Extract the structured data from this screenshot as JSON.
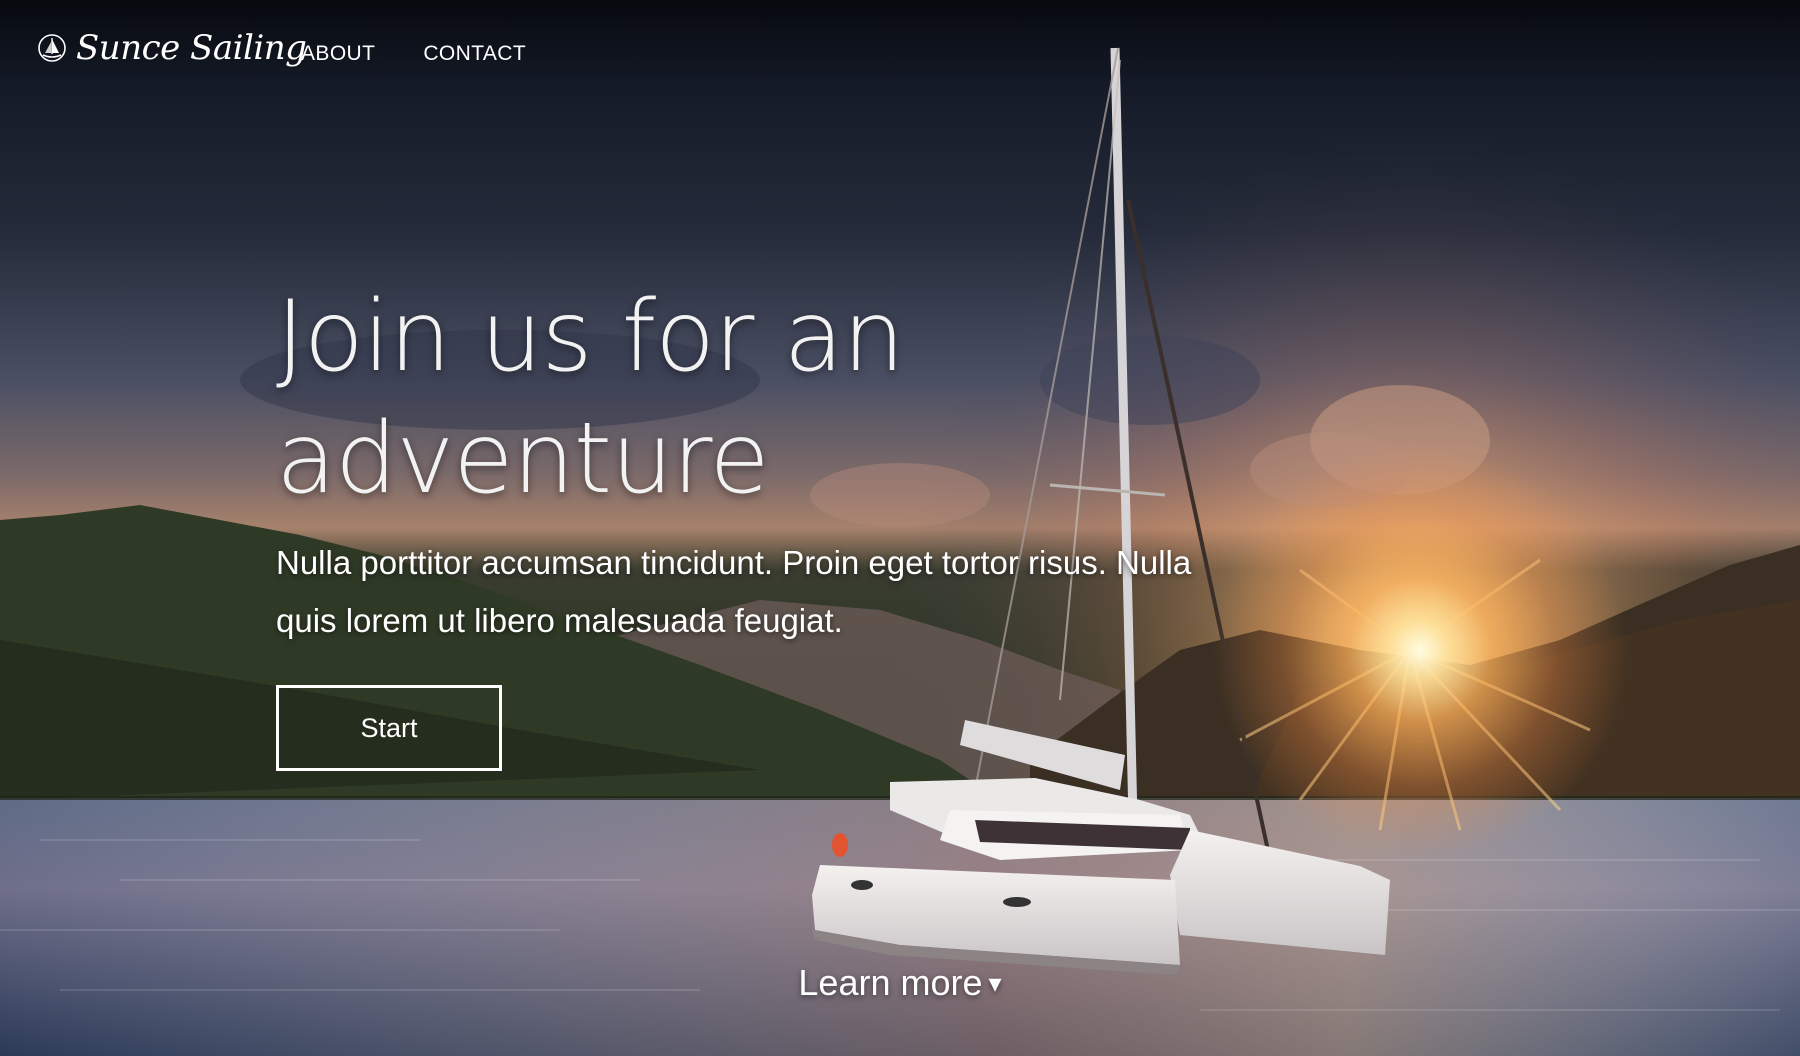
{
  "brand": {
    "name": "Sunce Sailing",
    "icon": "sailboat-logo-icon"
  },
  "nav": {
    "items": [
      {
        "label": "ABOUT"
      },
      {
        "label": "CONTACT"
      }
    ]
  },
  "hero": {
    "headline_line1": "Join us for an",
    "headline_line2": "adventure",
    "subtext_line1": "Nulla porttitor accumsan tincidunt. Proin eget tortor risus. Nulla",
    "subtext_line2": "quis lorem ut libero malesuada feugiat.",
    "cta_label": "Start",
    "learn_more_label": "Learn more",
    "learn_more_icon": "▾"
  },
  "colors": {
    "text": "#ffffff",
    "sky_dark": "#141a26",
    "sunset": "#f0a060",
    "water": "#4b5874"
  }
}
